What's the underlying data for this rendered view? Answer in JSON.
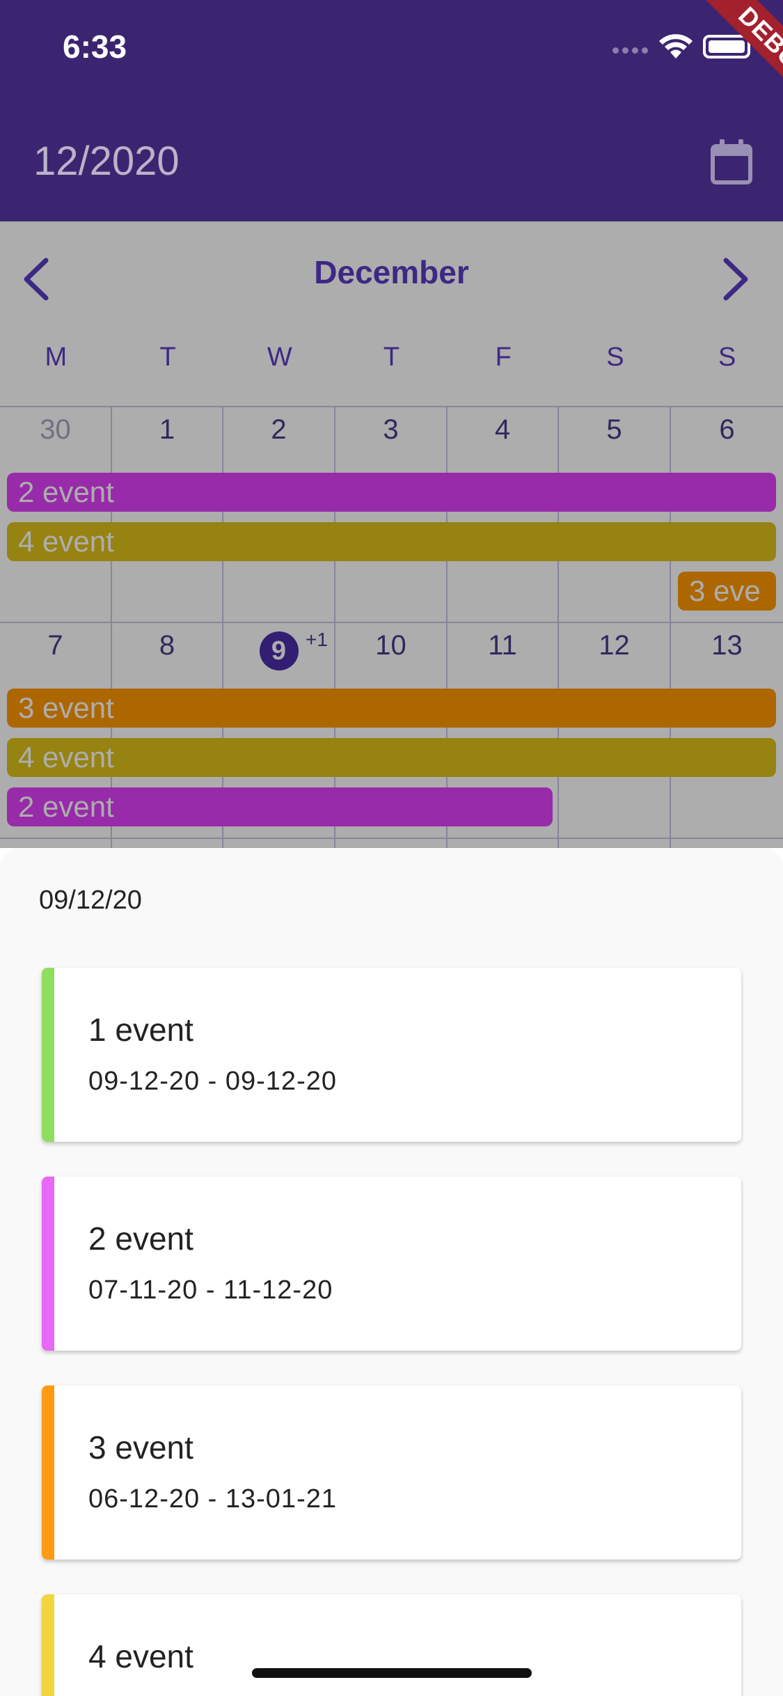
{
  "status_bar": {
    "time": "6:33"
  },
  "debug_banner": "DEBUG",
  "app_bar": {
    "title": "12/2020"
  },
  "calendar": {
    "month": "December",
    "weekdays": [
      "M",
      "T",
      "W",
      "T",
      "F",
      "S",
      "S"
    ],
    "week1": [
      "30",
      "1",
      "2",
      "3",
      "4",
      "5",
      "6"
    ],
    "week2": [
      "7",
      "8",
      "9",
      "10",
      "11",
      "12",
      "13"
    ],
    "today": "9",
    "today_more": "+1",
    "week1_events": [
      "2 event",
      "4 event",
      "3 eve"
    ],
    "week2_events": [
      "3 event",
      "4 event",
      "2 event"
    ]
  },
  "colors": {
    "purple_event": "#e040fb",
    "orange_event": "#ff9800",
    "yellow_event": "#ddc21a",
    "green_event": "#8fde5d",
    "app_bar": "#3c2570",
    "accent": "#5b3cc4"
  },
  "sheet": {
    "date": "09/12/20",
    "events": [
      {
        "title": "1 event",
        "range": "09-12-20 - 09-12-20",
        "color": "#8fde5d"
      },
      {
        "title": "2 event",
        "range": "07-11-20 - 11-12-20",
        "color": "#e868f8"
      },
      {
        "title": "3 event",
        "range": "06-12-20 - 13-01-21",
        "color": "#ff9a12"
      },
      {
        "title": "4 event",
        "range": "",
        "color": "#f2d53c"
      }
    ]
  }
}
